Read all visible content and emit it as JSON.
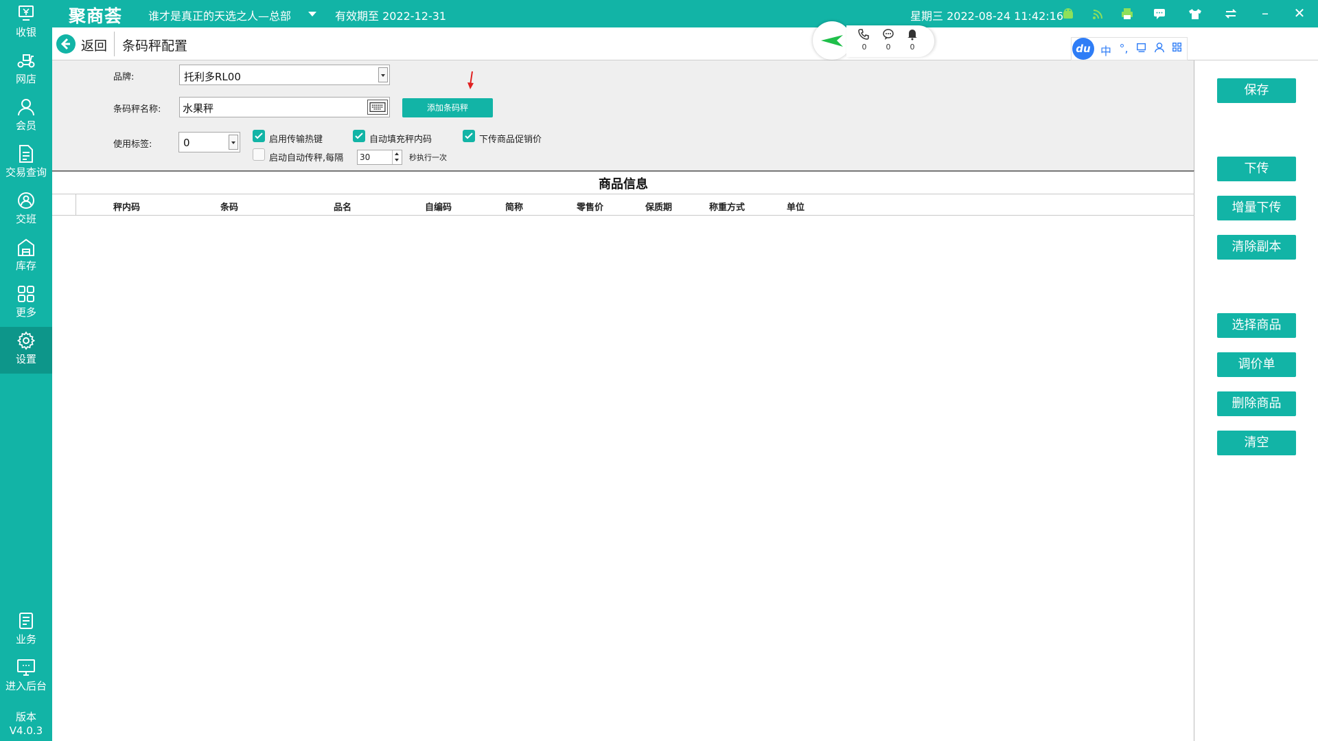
{
  "topbar": {
    "logo": "聚商荟",
    "store_name": "谁才是真正的天选之人—总部",
    "expiry": "有效期至 2022-12-31",
    "datetime": "星期三 2022-08-24 11:42:16",
    "accent_color": "#12b4a6",
    "icons": [
      "android-icon",
      "wifi-icon",
      "printer-icon",
      "message-icon",
      "shirt-icon",
      "switch-icon",
      "minimize-icon",
      "close-icon"
    ]
  },
  "sidebar": {
    "items": [
      {
        "label": "收银",
        "icon": "cashier-icon"
      },
      {
        "label": "网店",
        "icon": "scooter-icon"
      },
      {
        "label": "会员",
        "icon": "user-icon"
      },
      {
        "label": "交易查询",
        "icon": "document-icon"
      },
      {
        "label": "交班",
        "icon": "shift-icon"
      },
      {
        "label": "库存",
        "icon": "warehouse-icon"
      },
      {
        "label": "更多",
        "icon": "grid-icon"
      },
      {
        "label": "设置",
        "icon": "gear-icon"
      },
      {
        "label": "业务",
        "icon": "business-icon"
      },
      {
        "label": "进入后台",
        "icon": "monitor-icon"
      }
    ],
    "active": "设置",
    "version_label": "版本",
    "version": "V4.0.3"
  },
  "header": {
    "back_label": "返回",
    "page_title": "条码秤配置",
    "counters": [
      {
        "icon": "phone-icon",
        "value": "0"
      },
      {
        "icon": "chat-icon",
        "value": "0"
      },
      {
        "icon": "bell-icon",
        "value": "0"
      }
    ]
  },
  "ime": {
    "logo": "du",
    "items": [
      "中",
      "°,"
    ]
  },
  "form": {
    "brand_label": "品牌:",
    "brand_value": "托利多RL00",
    "scale_name_label": "条码秤名称:",
    "scale_name_value": "水果秤",
    "add_scale_button": "添加条码秤",
    "tag_label": "使用标签:",
    "tag_value": "0",
    "hotkey_label": "启用传输热键",
    "hotkey_checked": true,
    "autofill_label": "自动填充秤内码",
    "autofill_checked": true,
    "promo_label": "下传商品促销价",
    "promo_checked": true,
    "auto_send_label": "启动自动传秤,每隔",
    "auto_send_checked": false,
    "interval_value": "30",
    "interval_suffix": "秒执行一次"
  },
  "table": {
    "title": "商品信息",
    "columns": [
      "秤内码",
      "条码",
      "品名",
      "自编码",
      "简称",
      "零售价",
      "保质期",
      "称重方式",
      "单位"
    ],
    "rows": []
  },
  "actions": {
    "save": "保存",
    "download": "下传",
    "incremental_download": "增量下传",
    "clear_copy": "清除副本",
    "select_goods": "选择商品",
    "price_adjust": "调价单",
    "delete_goods": "删除商品",
    "clear_all": "清空"
  }
}
